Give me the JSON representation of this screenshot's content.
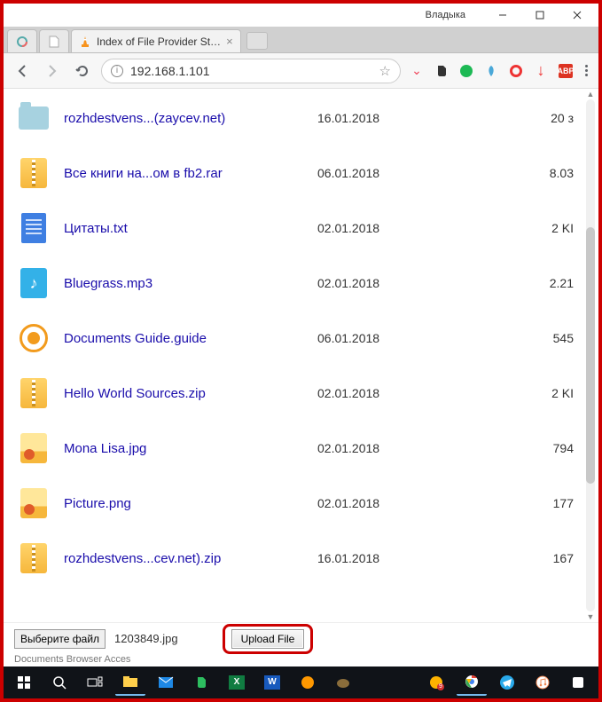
{
  "window": {
    "user_label": "Владыка",
    "tab_title": "Index of File Provider St…",
    "below_text": "Documents Browser Acces"
  },
  "nav": {
    "url": "192.168.1.101"
  },
  "files": [
    {
      "icon": "folder",
      "name": "rozhdestvens...(zaycev.net)",
      "date": "16.01.2018",
      "size": "20 з"
    },
    {
      "icon": "zip",
      "name": "Все книги на...ом в fb2.rar",
      "date": "06.01.2018",
      "size": "8.03"
    },
    {
      "icon": "doc",
      "name": "Цитаты.txt",
      "date": "02.01.2018",
      "size": "2 KI"
    },
    {
      "icon": "audio",
      "name": "Bluegrass.mp3",
      "date": "02.01.2018",
      "size": "2.21"
    },
    {
      "icon": "guide",
      "name": "Documents Guide.guide",
      "date": "06.01.2018",
      "size": "545"
    },
    {
      "icon": "zip",
      "name": "Hello World Sources.zip",
      "date": "02.01.2018",
      "size": "2 KI"
    },
    {
      "icon": "img",
      "name": "Mona Lisa.jpg",
      "date": "02.01.2018",
      "size": "794"
    },
    {
      "icon": "img",
      "name": "Picture.png",
      "date": "02.01.2018",
      "size": "177"
    },
    {
      "icon": "zip",
      "name": "rozhdestvens...cev.net).zip",
      "date": "16.01.2018",
      "size": "167"
    }
  ],
  "upload": {
    "pick_label": "Выберите файл",
    "selected_file": "1203849.jpg",
    "upload_label": "Upload File"
  },
  "ext_icons": {
    "pocket": "pocket-icon",
    "evernote": "evernote-icon",
    "green": "green-dot-icon",
    "browsec": "browsec-icon",
    "opera": "opera-icon",
    "down": "download-icon",
    "adblock": "adblock-icon"
  }
}
